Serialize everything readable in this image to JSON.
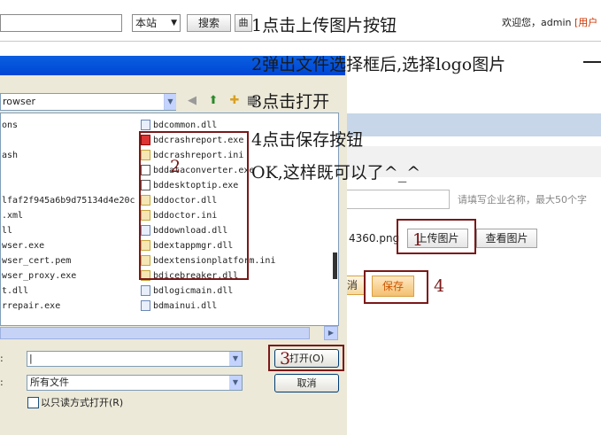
{
  "web": {
    "site_select": "本站",
    "search_button": "搜索",
    "menu_button_glyph": "曲",
    "welcome": "欢迎您，admin",
    "welcome_user": "[用户",
    "name_hint": "请填写企业名称，最大50个字",
    "filename": "4360.png",
    "upload_button": "上传图片",
    "view_button": "查看图片",
    "cancel_button": "消",
    "save_button": "保存"
  },
  "dialog": {
    "lookin_value": "rowser",
    "filename_value": "|",
    "filetype_value": "所有文件",
    "open_button": "打开(O)",
    "cancel_button": "取消",
    "readonly_label": "以只读方式打开(R)",
    "left_files": [
      "ons",
      "ash",
      "lfaf2f945a6b9d75134d4e20c",
      ".xml",
      "ll",
      "wser.exe",
      "wser_cert.pem",
      "wser_proxy.exe",
      "t.dll",
      "rrepair.exe"
    ],
    "right_files": [
      "bdcommon.dll",
      "bdcrashreport.exe",
      "bdcrashreport.ini",
      "bddataconverter.exe",
      "bddesktoptip.exe",
      "bddoctor.dll",
      "bddoctor.ini",
      "bddownload.dll",
      "bdextappmgr.dll",
      "bdextensionplatform.ini",
      "bdicebreaker.dll",
      "bdlogicmain.dll",
      "bdmainui.dll"
    ]
  },
  "annotations": {
    "step1": "1点击上传图片按钮",
    "step2": "2弹出文件选择框后,选择logo图片",
    "step3": "3点击打开",
    "step4": "4点击保存按钮",
    "ok": "OK,这样既可以了^_^",
    "box1_num": "1",
    "box2_num": "2",
    "box3_num": "3",
    "box4_num": "4"
  },
  "colors": {
    "annotation_red": "#7b1818",
    "dialog_bg": "#ece9d8",
    "save_orange": "#cc5500"
  }
}
